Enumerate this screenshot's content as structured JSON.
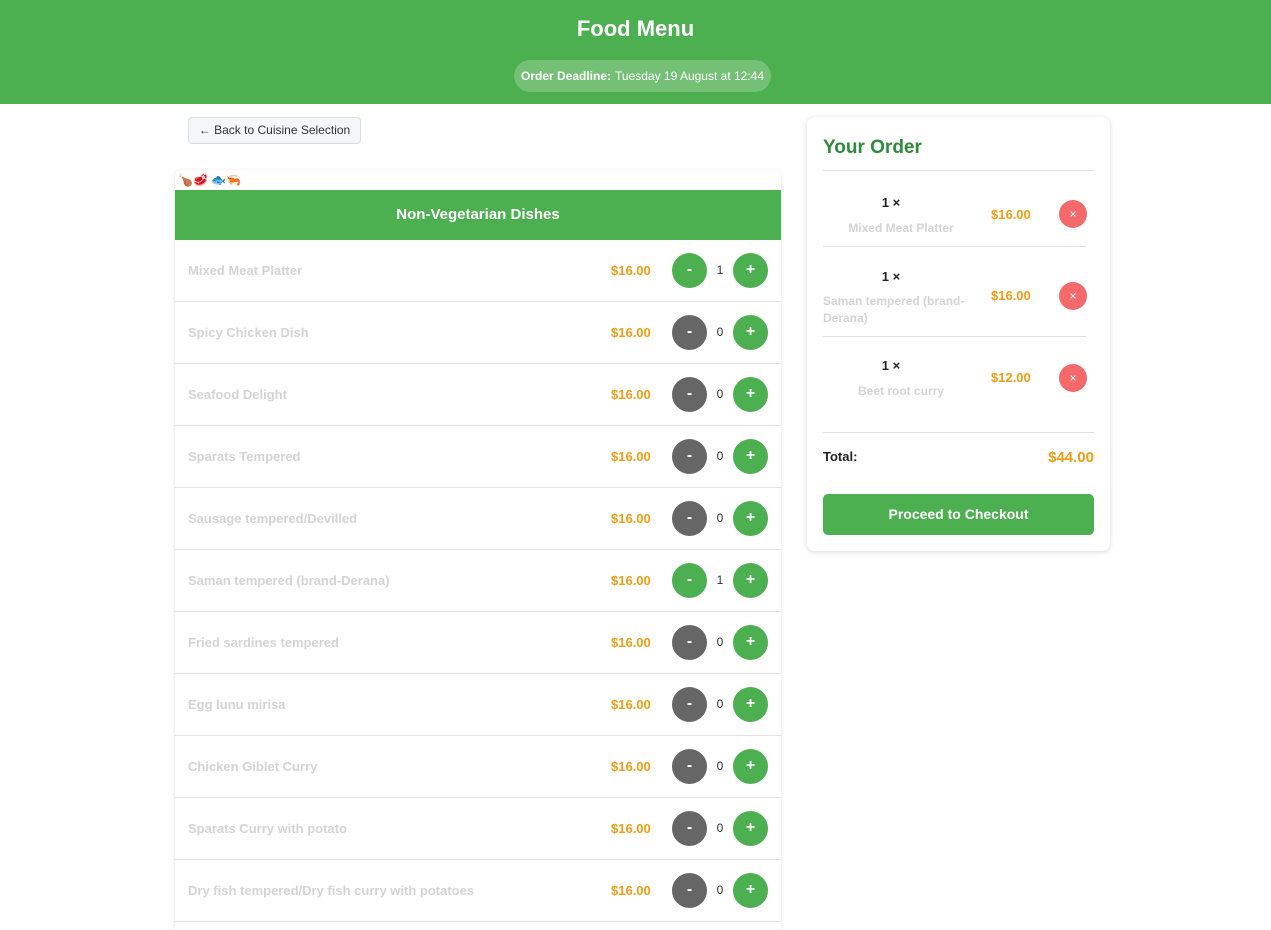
{
  "header": {
    "title": "Food Menu",
    "deadline_label": "Order Deadline:",
    "deadline_value": "Tuesday 19 August at 12:44"
  },
  "back_button": "← Back to Cuisine Selection",
  "category": {
    "icons": "🍗🥩 🐟🦐",
    "title": "Non-Vegetarian Dishes"
  },
  "menu_items": [
    {
      "name": "Mixed Meat Platter",
      "price": "$16.00",
      "qty": "1"
    },
    {
      "name": "Spicy Chicken Dish",
      "price": "$16.00",
      "qty": "0"
    },
    {
      "name": "Seafood Delight",
      "price": "$16.00",
      "qty": "0"
    },
    {
      "name": "Sparats Tempered",
      "price": "$16.00",
      "qty": "0"
    },
    {
      "name": "Sausage tempered/Devilled",
      "price": "$16.00",
      "qty": "0"
    },
    {
      "name": "Saman tempered (brand-Derana)",
      "price": "$16.00",
      "qty": "1"
    },
    {
      "name": "Fried sardines tempered",
      "price": "$16.00",
      "qty": "0"
    },
    {
      "name": "Egg lunu mirisa",
      "price": "$16.00",
      "qty": "0"
    },
    {
      "name": "Chicken Giblet Curry",
      "price": "$16.00",
      "qty": "0"
    },
    {
      "name": "Sparats Curry with potato",
      "price": "$16.00",
      "qty": "0"
    },
    {
      "name": "Dry fish tempered/Dry fish curry with potatoes",
      "price": "$16.00",
      "qty": "0"
    }
  ],
  "controls": {
    "minus": "-",
    "plus": "+",
    "remove": "×"
  },
  "order": {
    "title": "Your Order",
    "items": [
      {
        "qty": "1 ×",
        "name": "Mixed Meat Platter",
        "price": "$16.00"
      },
      {
        "qty": "1 ×",
        "name": "Saman tempered (brand-Derana)",
        "price": "$16.00"
      },
      {
        "qty": "1 ×",
        "name": "Beet root curry",
        "price": "$12.00"
      }
    ],
    "total_label": "Total:",
    "total_value": "$44.00",
    "checkout_label": "Proceed to Checkout"
  },
  "colors": {
    "primary": "#4caf50",
    "price": "#f39c12",
    "minus_inactive": "#666666",
    "remove": "#f46a6a"
  }
}
